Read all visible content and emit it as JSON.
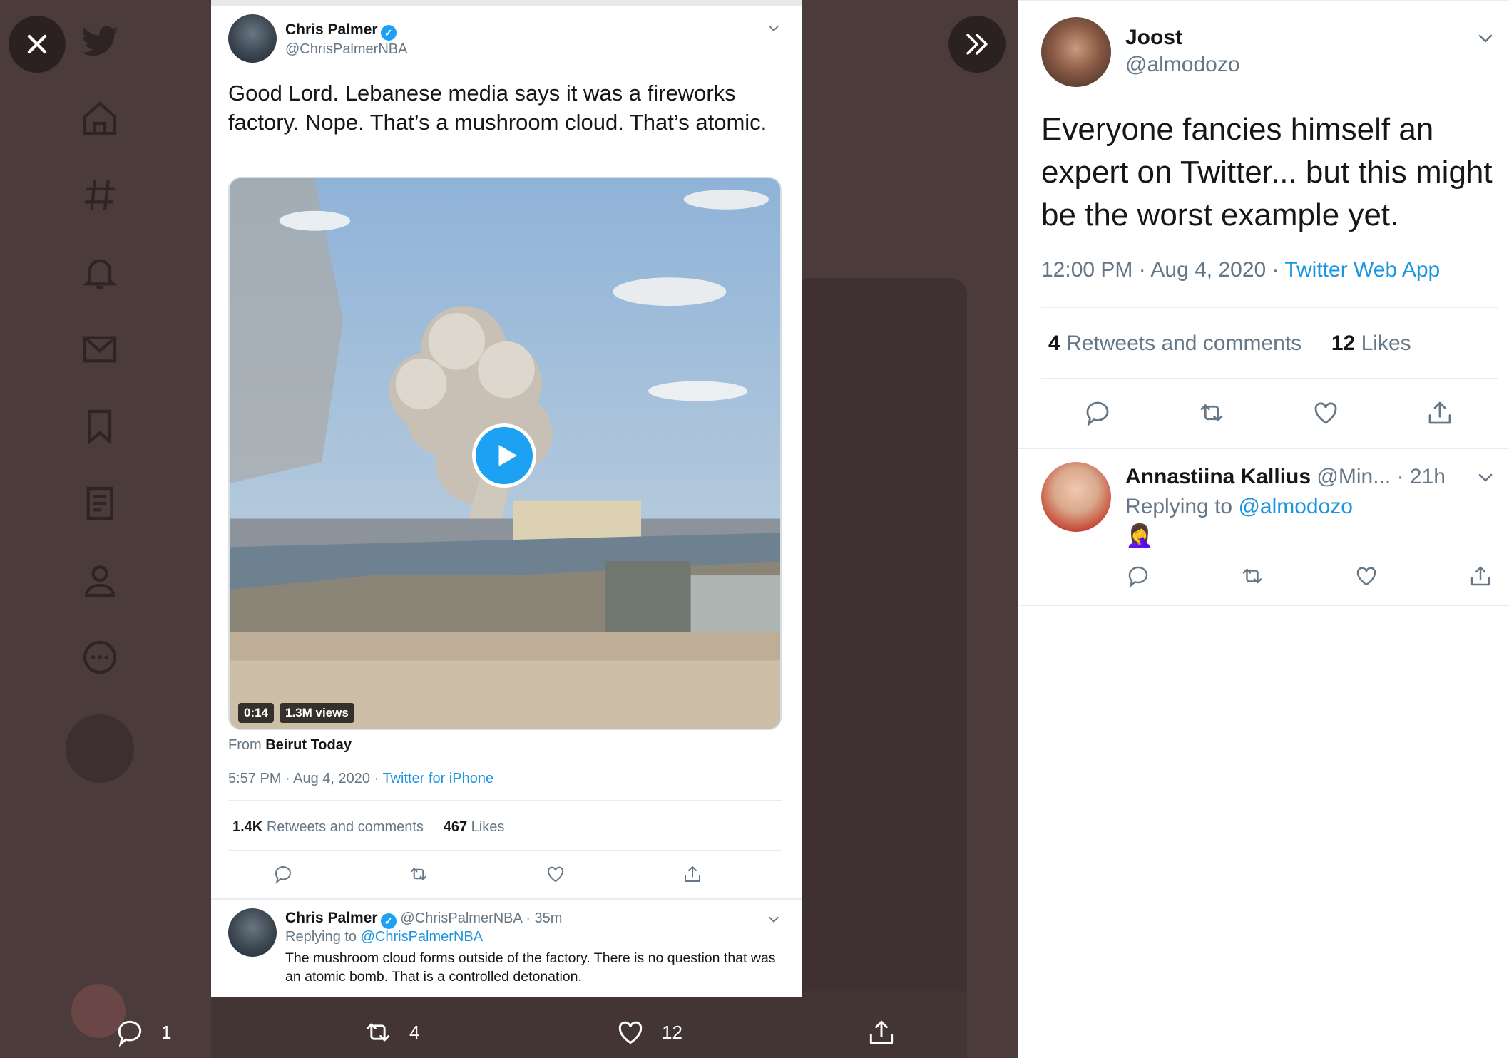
{
  "media_tweet": {
    "author_name": "Chris Palmer",
    "author_handle": "@ChrisPalmerNBA",
    "text": "Good Lord. Lebanese media says it was a fireworks factory. Nope. That’s a mushroom cloud. That’s atomic.",
    "video_duration": "0:14",
    "video_views": "1.3M views",
    "from_prefix": "From",
    "from_source": "Beirut Today",
    "timestamp": "5:57 PM · Aug 4, 2020 · ",
    "client": "Twitter for iPhone",
    "retweets_count": "1.4K",
    "retweets_label": "Retweets and comments",
    "likes_count": "467",
    "likes_label": "Likes",
    "reply": {
      "author_name": "Chris Palmer",
      "author_handle": "@ChrisPalmerNBA · 35m",
      "replying_prefix": "Replying to",
      "replying_to": "@ChrisPalmerNBA",
      "text": "The mushroom cloud forms outside of the factory. There is no question that was an atomic bomb. That is a controlled detonation."
    }
  },
  "overlay_actions": {
    "replies": "1",
    "retweets": "4",
    "likes": "12"
  },
  "panel": {
    "author_name": "Joost",
    "author_handle": "@almodozo",
    "text": "Everyone fancies himself an expert on Twitter... but this might be the worst example yet.",
    "timestamp": "12:00 PM · Aug 4, 2020 · ",
    "client": "Twitter Web App",
    "retweets_count": "4",
    "retweets_label": "Retweets and comments",
    "likes_count": "12",
    "likes_label": "Likes",
    "reply": {
      "author_name": "Annastiina Kallius",
      "author_handle": "@Min...",
      "time": "· 21h",
      "replying_prefix": "Replying to",
      "replying_to": "@almodozo",
      "emoji": "🤦‍♀️"
    }
  },
  "colors": {
    "accent": "#1da1f2",
    "link": "#1b95e0",
    "overlay": "#4b3b3b",
    "secondary_text": "#657786"
  },
  "icons": [
    "close-icon",
    "expand-icon",
    "reply-icon",
    "retweet-icon",
    "like-icon",
    "share-icon",
    "verified-icon",
    "caret-down-icon",
    "play-icon"
  ]
}
